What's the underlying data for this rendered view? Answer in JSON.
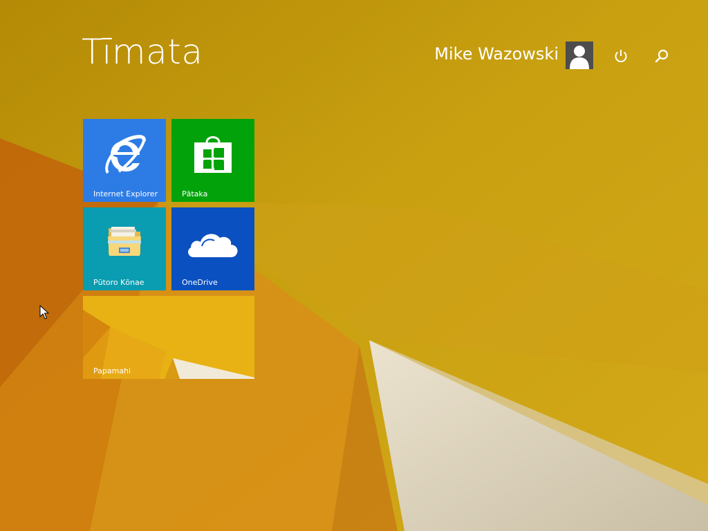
{
  "start_screen": {
    "title": "Tīmata"
  },
  "user": {
    "name": "Mike Wazowski",
    "avatar_icon": "user-avatar-icon"
  },
  "top_buttons": {
    "power_icon": "power-icon",
    "search_icon": "search-icon"
  },
  "tiles": [
    {
      "label": "Internet Explorer",
      "icon": "internet-explorer-icon",
      "color": "#2d7ce6"
    },
    {
      "label": "Pātaka",
      "icon": "store-icon",
      "color": "#02a20b"
    },
    {
      "label": "Pūtoro Kōnae",
      "icon": "file-explorer-icon",
      "color": "#0a9cb0"
    },
    {
      "label": "OneDrive",
      "icon": "onedrive-icon",
      "color": "#0a50c0"
    },
    {
      "label": "Papamahi",
      "icon": "desktop-wallpaper-thumbnail",
      "color": "#e2ab10"
    }
  ],
  "colors": {
    "wallpaper_base": "#c2980a",
    "text": "#ffffff"
  }
}
